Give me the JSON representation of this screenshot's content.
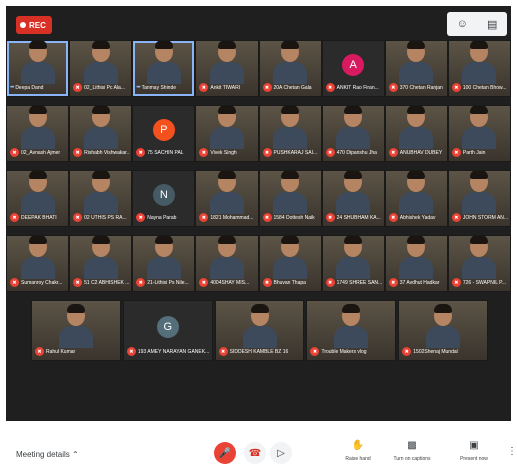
{
  "recording": {
    "label": "REC",
    "color": "#d93025"
  },
  "top_icons": [
    "people-icon",
    "chat-icon"
  ],
  "participants": [
    {
      "name": "Deepa Dand",
      "type": "video",
      "muted": false,
      "speaking": true
    },
    {
      "name": "02_Lithisi Pc Ala...",
      "type": "video",
      "muted": true
    },
    {
      "name": "Tanmay Shinde",
      "type": "video",
      "muted": false,
      "speaking": true
    },
    {
      "name": "Ankit TIWARI",
      "type": "video",
      "muted": true
    },
    {
      "name": "20A Chetan Gala",
      "type": "video",
      "muted": true
    },
    {
      "name": "ANKIT Rao Firan...",
      "type": "avatar",
      "initial": "A",
      "color": "#d81b60",
      "muted": true
    },
    {
      "name": "370 Chetan Ranjan",
      "type": "video",
      "muted": true
    },
    {
      "name": "100 Chetan Bhow...",
      "type": "video",
      "muted": true
    },
    {
      "name": "02_Avnash Ajmer",
      "type": "video",
      "muted": true
    },
    {
      "name": "Rishabh Vishwakar...",
      "type": "video",
      "muted": true
    },
    {
      "name": "75 SACHIN PAL",
      "type": "avatar",
      "initial": "P",
      "color": "#f4511e",
      "muted": true
    },
    {
      "name": "Vivek Singh",
      "type": "video",
      "muted": true
    },
    {
      "name": "PUSHKARAJ SAI...",
      "type": "video",
      "muted": true
    },
    {
      "name": "470 Dipanshu Jha",
      "type": "video",
      "muted": true
    },
    {
      "name": "ANUBHAV DUBEY",
      "type": "video",
      "muted": true
    },
    {
      "name": "Parth Jain",
      "type": "video",
      "muted": true
    },
    {
      "name": "DEEPAK BHATI",
      "type": "video",
      "muted": true
    },
    {
      "name": "02 UTHIS PS RA...",
      "type": "video",
      "muted": true
    },
    {
      "name": "Nayna Parab",
      "type": "avatar",
      "initial": "N",
      "color": "#455a64",
      "muted": true
    },
    {
      "name": "1821 Mohammad...",
      "type": "video",
      "muted": true
    },
    {
      "name": "1584 Dottesh Naik",
      "type": "video",
      "muted": true
    },
    {
      "name": "24 SHUBHAM KA...",
      "type": "video",
      "muted": true
    },
    {
      "name": "Abhishek Yadav",
      "type": "video",
      "muted": true
    },
    {
      "name": "JOHN STORM AN...",
      "type": "video",
      "muted": true
    },
    {
      "name": "Sumanroy Chakr...",
      "type": "video",
      "muted": true
    },
    {
      "name": "51 C2 ABHISHEK ...",
      "type": "video",
      "muted": true
    },
    {
      "name": "21-Lithisi Ps Nile...",
      "type": "video",
      "muted": true
    },
    {
      "name": "4004SHAY MIS...",
      "type": "video",
      "muted": true
    },
    {
      "name": "Bhuvan Thapa",
      "type": "video",
      "muted": true
    },
    {
      "name": "1749 SHREE SAN...",
      "type": "video",
      "muted": true
    },
    {
      "name": "37 Avdhut Hadkar",
      "type": "video",
      "muted": true
    },
    {
      "name": "726 - SWAPNIL P...",
      "type": "video",
      "muted": true
    }
  ],
  "last_row": [
    {
      "name": "Rahul Kumar",
      "type": "video",
      "muted": true
    },
    {
      "name": "193 AMEY NARAYAN GANEK...",
      "type": "avatar",
      "initial": "G",
      "color": "#546e7a",
      "muted": true
    },
    {
      "name": "SIDDESH KAMBLE BZ 16",
      "type": "video",
      "muted": true
    },
    {
      "name": "Trouble Makers vlog",
      "type": "video",
      "muted": true
    },
    {
      "name": "1502Shenaj Mundal",
      "type": "video",
      "muted": true
    }
  ],
  "bottom_bar": {
    "meeting_details": "Meeting details",
    "raise_hand": "Raise hand",
    "captions": "Turn on captions",
    "present": "Present now"
  }
}
